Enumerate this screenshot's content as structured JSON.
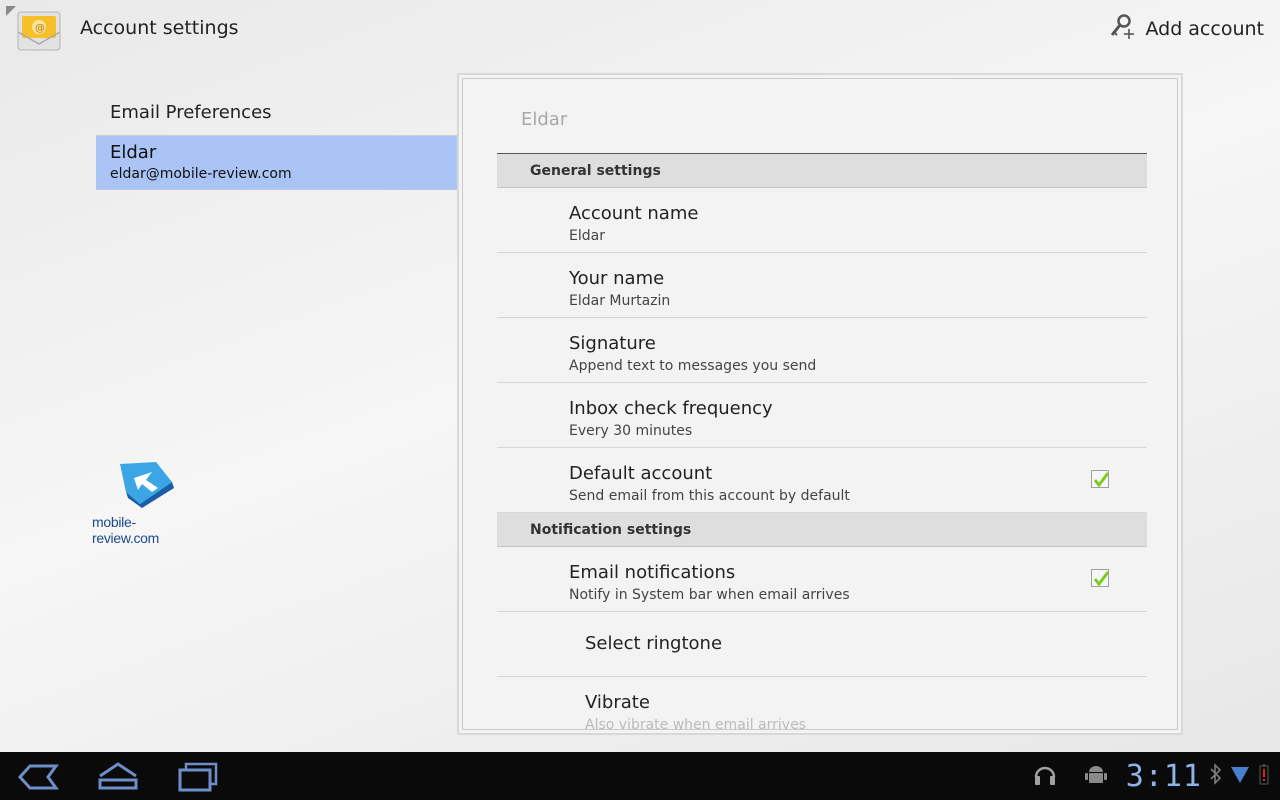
{
  "header": {
    "title": "Account settings",
    "add_account_label": "Add account",
    "app_icon": "email-app-icon",
    "add_account_icon": "key-plus-icon"
  },
  "sidebar": {
    "preferences_label": "Email Preferences",
    "account": {
      "name": "Eldar",
      "email": "eldar@mobile-review.com"
    },
    "selection_color": "#a9c4f5"
  },
  "watermark": {
    "text": "mobile-review.com"
  },
  "panel": {
    "title": "Eldar",
    "general_header": "General settings",
    "general_rows": [
      {
        "title": "Account name",
        "summary": "Eldar"
      },
      {
        "title": "Your name",
        "summary": "Eldar Murtazin"
      },
      {
        "title": "Signature",
        "summary": "Append text to messages you send"
      },
      {
        "title": "Inbox check frequency",
        "summary": "Every 30 minutes"
      },
      {
        "title": "Default account",
        "summary": "Send email from this account by default",
        "checked": true
      }
    ],
    "notification_header": "Notification settings",
    "notification_rows": [
      {
        "title": "Email notifications",
        "summary": "Notify in System bar when email arrives",
        "checked": true
      },
      {
        "title": "Select ringtone"
      },
      {
        "title": "Vibrate",
        "summary": "Also vibrate when email arrives"
      }
    ]
  },
  "system_bar": {
    "clock": "3:11",
    "nav_icons": [
      "back-icon",
      "home-icon",
      "recent-apps-icon"
    ],
    "status_icons": [
      "headphones-icon",
      "android-debug-icon",
      "bluetooth-icon",
      "wifi-icon",
      "battery-low-icon"
    ],
    "accent_color": "#8fb3e6"
  }
}
